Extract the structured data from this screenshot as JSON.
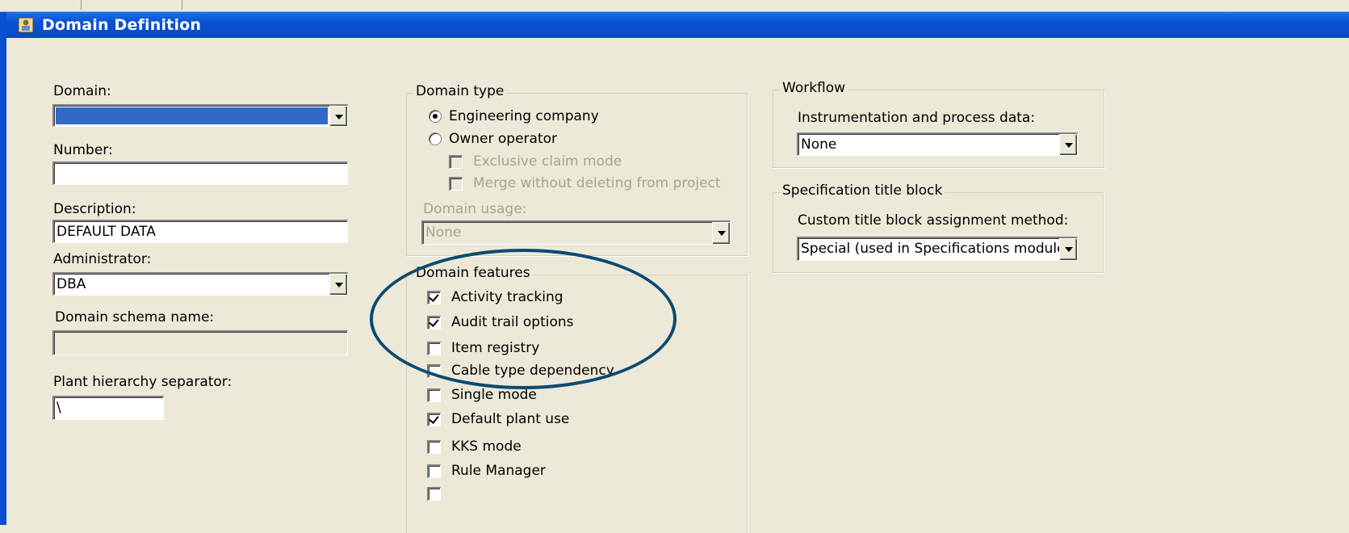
{
  "window": {
    "title": "Domain Definition"
  },
  "left": {
    "domain_label": "Domain:",
    "domain_value": "",
    "number_label": "Number:",
    "number_value": "",
    "description_label": "Description:",
    "description_value": "DEFAULT DATA",
    "administrator_label": "Administrator:",
    "administrator_value": "DBA",
    "schema_label": "Domain schema name:",
    "schema_value": "",
    "separator_label": "Plant hierarchy separator:",
    "separator_value": "\\"
  },
  "domain_type": {
    "legend": "Domain type",
    "engineering_label": "Engineering company",
    "owner_label": "Owner operator",
    "selected": "Engineering company",
    "exclusive_label": "Exclusive claim mode",
    "merge_label": "Merge without deleting from project",
    "usage_label": "Domain usage:",
    "usage_value": "None"
  },
  "domain_features": {
    "legend": "Domain features",
    "items": [
      {
        "label": "Activity tracking",
        "checked": true
      },
      {
        "label": "Audit trail options",
        "checked": true
      },
      {
        "label": "Item registry",
        "checked": false
      },
      {
        "label": "Cable type dependency",
        "checked": false
      },
      {
        "label": "Single mode",
        "checked": false
      },
      {
        "label": "Default plant use",
        "checked": true
      },
      {
        "label": "KKS mode",
        "checked": false
      },
      {
        "label": "Rule Manager",
        "checked": false
      }
    ]
  },
  "workflow": {
    "legend": "Workflow",
    "label": "Instrumentation and process data:",
    "value": "None"
  },
  "spec_title": {
    "legend": "Specification title block",
    "label": "Custom title block assignment method:",
    "value": "Special (used in Specifications module c"
  },
  "colors": {
    "titlebar": "#0a52d6",
    "annotation": "#0d4a70",
    "dialog_bg": "#ece9d8"
  }
}
